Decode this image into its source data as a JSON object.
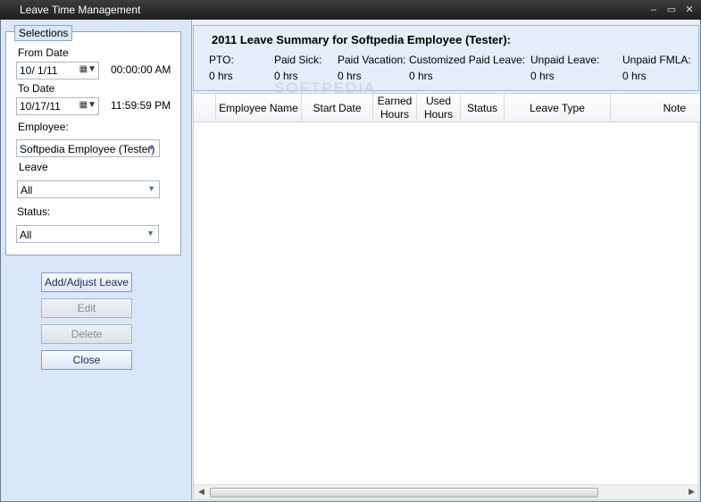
{
  "window": {
    "title": "Leave Time Management",
    "controls": {
      "minimize": "‒",
      "maximize": "▭",
      "close": "✕"
    }
  },
  "selections": {
    "legend": "Selections",
    "from_date_label": "From Date",
    "from_date_value": "10/  1/11",
    "from_time": "00:00:00 AM",
    "to_date_label": "To Date",
    "to_date_value": "10/17/11",
    "to_time": "11:59:59 PM",
    "employee_label": "Employee:",
    "employee_value": "Softpedia Employee (Tester)",
    "leave_label": "Leave",
    "leave_value": "All",
    "status_label": "Status:",
    "status_value": "All"
  },
  "buttons": {
    "add_adjust": "Add/Adjust Leave",
    "edit": "Edit",
    "delete": "Delete",
    "close": "Close"
  },
  "summary": {
    "title": "2011 Leave Summary for Softpedia Employee (Tester):",
    "items": [
      {
        "label": "PTO:",
        "value": "0 hrs"
      },
      {
        "label": "Paid Sick:",
        "value": "0 hrs"
      },
      {
        "label": "Paid Vacation:",
        "value": "0 hrs"
      },
      {
        "label": "Customized Paid Leave:",
        "value": "0 hrs"
      },
      {
        "label": "Unpaid Leave:",
        "value": "0 hrs"
      },
      {
        "label": "Unpaid FMLA:",
        "value": "0 hrs"
      }
    ]
  },
  "grid": {
    "columns": [
      "Employee Name",
      "Start Date",
      "Earned Hours",
      "Used Hours",
      "Status",
      "Leave Type",
      "Note"
    ],
    "rows": []
  },
  "watermark": "SOFTPEDIA"
}
